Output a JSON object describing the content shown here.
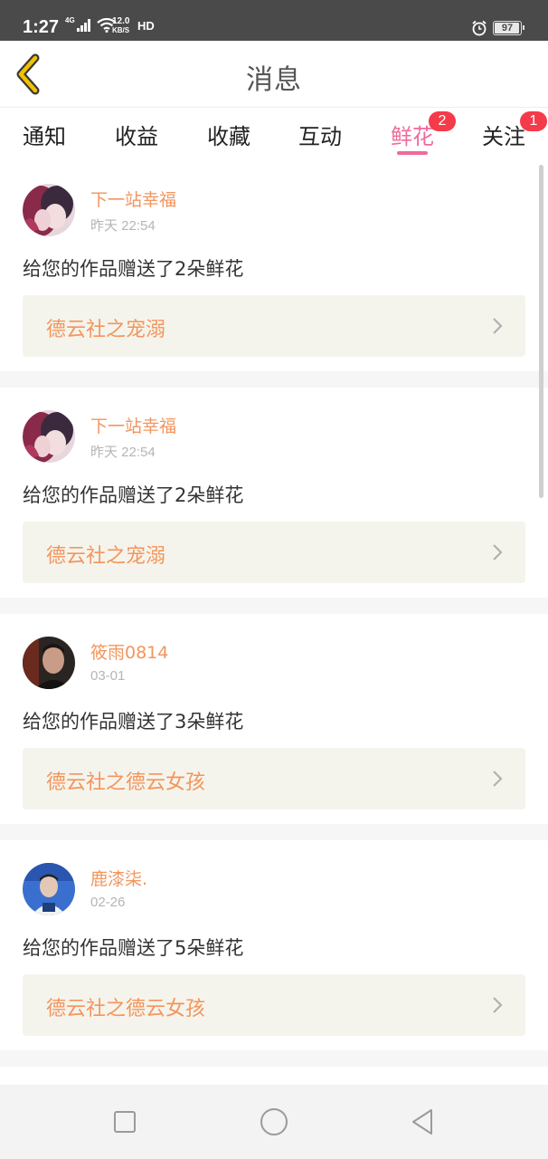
{
  "status_bar": {
    "time": "1:27",
    "network": "4G",
    "speed_value": "12.0",
    "speed_unit": "KB/S",
    "hd": "HD",
    "battery": "97"
  },
  "header": {
    "title": "消息"
  },
  "tabs": [
    {
      "label": "通知"
    },
    {
      "label": "收益"
    },
    {
      "label": "收藏"
    },
    {
      "label": "互动"
    },
    {
      "label": "鲜花",
      "badge": "2",
      "active": true
    },
    {
      "label": "关注",
      "badge": "1"
    }
  ],
  "messages": [
    {
      "username": "下一站幸福",
      "time": "昨天 22:54",
      "text": "给您的作品赠送了2朵鲜花",
      "work": "德云社之宠溺"
    },
    {
      "username": "下一站幸福",
      "time": "昨天 22:54",
      "text": "给您的作品赠送了2朵鲜花",
      "work": "德云社之宠溺"
    },
    {
      "username": "筱雨0814",
      "time": "03-01",
      "text": "给您的作品赠送了3朵鲜花",
      "work": "德云社之德云女孩"
    },
    {
      "username": "鹿漆柒.",
      "time": "02-26",
      "text": "给您的作品赠送了5朵鲜花",
      "work": "德云社之德云女孩"
    }
  ],
  "colors": {
    "accent": "#f06a9b",
    "badge": "#f53a4a",
    "username": "#f3955d",
    "back_arrow": "#e8b400"
  },
  "icons": {
    "back": "back-arrow-icon",
    "chevron": "chevron-right-icon",
    "nav_recent": "square-icon",
    "nav_home": "circle-icon",
    "nav_back": "triangle-back-icon"
  }
}
